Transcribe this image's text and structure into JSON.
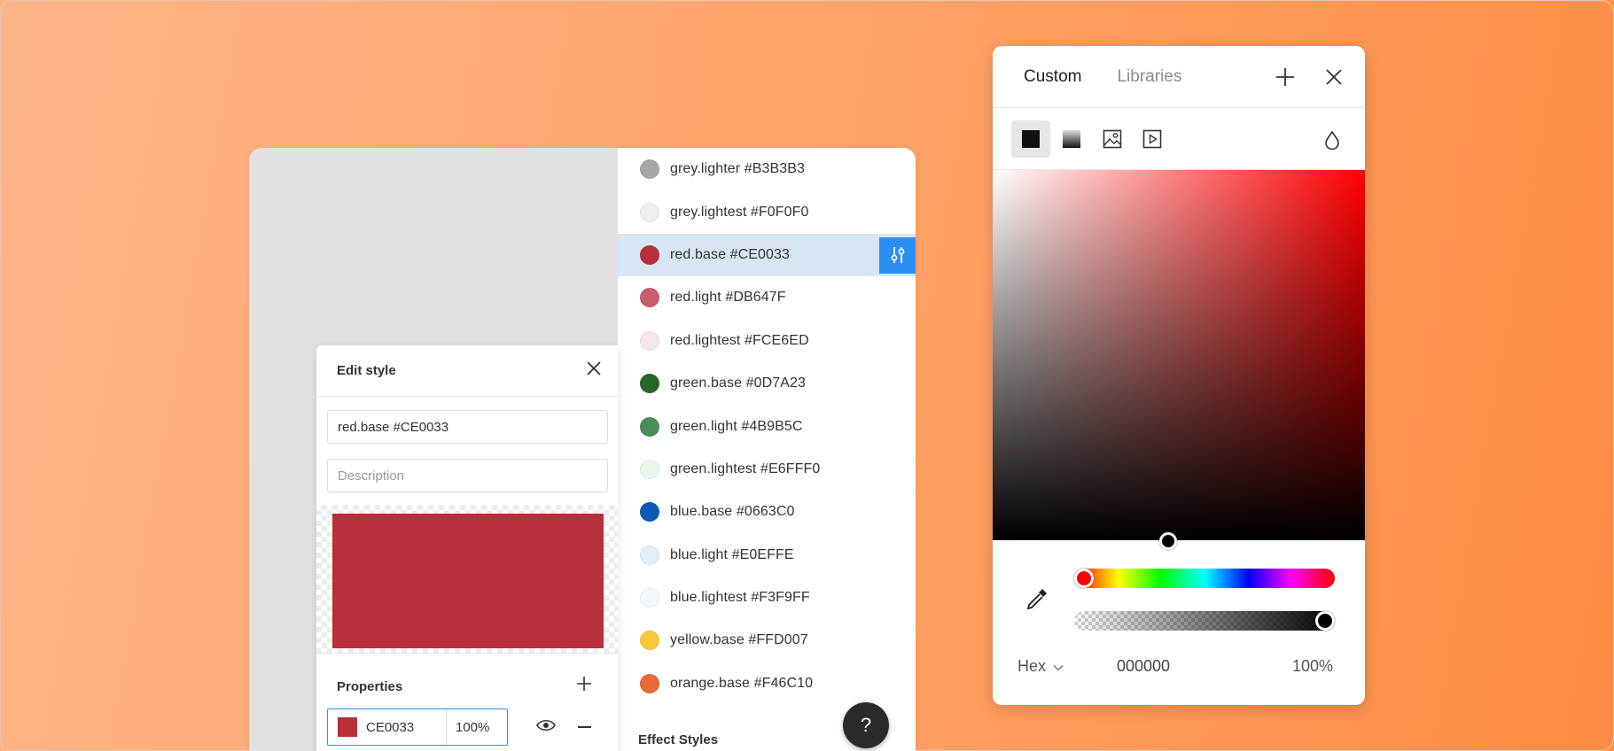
{
  "style_list": {
    "items": [
      {
        "label": "grey.lighter #B3B3B3",
        "color": "#A7A7A7",
        "selected": false
      },
      {
        "label": "grey.lightest #F0F0F0",
        "color": "#EFEFEF",
        "selected": false
      },
      {
        "label": "red.base #CE0033",
        "color": "#B82F39",
        "selected": true
      },
      {
        "label": "red.light #DB647F",
        "color": "#C95D6E",
        "selected": false
      },
      {
        "label": "red.lightest #FCE6ED",
        "color": "#F7E5EA",
        "selected": false
      },
      {
        "label": "green.base #0D7A23",
        "color": "#26662A",
        "selected": false
      },
      {
        "label": "green.light #4B9B5C",
        "color": "#4C8C58",
        "selected": false
      },
      {
        "label": "green.lightest #E6FFF0",
        "color": "#E6FAEC",
        "selected": false
      },
      {
        "label": "blue.base #0663C0",
        "color": "#0D5AB4",
        "selected": false
      },
      {
        "label": "blue.light #E0EFFE",
        "color": "#E2EDFC",
        "selected": false
      },
      {
        "label": "blue.lightest #F3F9FF",
        "color": "#F3F7FE",
        "selected": false
      },
      {
        "label": "yellow.base #FFD007",
        "color": "#F8C73D",
        "selected": false
      },
      {
        "label": "orange.base #F46C10",
        "color": "#E96A35",
        "selected": false
      }
    ],
    "effect_styles_title": "Effect Styles",
    "help_label": "?"
  },
  "edit_style": {
    "title": "Edit style",
    "name_value": "red.base #CE0033",
    "description_placeholder": "Description",
    "preview_color": "#B82F39",
    "properties_title": "Properties",
    "property": {
      "hex": "CE0033",
      "opacity": "100%",
      "swatch_color": "#B82F39"
    }
  },
  "color_picker": {
    "tabs": [
      {
        "label": "Custom",
        "active": true
      },
      {
        "label": "Libraries",
        "active": false
      }
    ],
    "fill_types": [
      "solid-fill-icon",
      "gradient-fill-icon",
      "image-fill-icon",
      "video-fill-icon"
    ],
    "mode": "Hex",
    "hex_value": "000000",
    "alpha_value": "100%",
    "hue_level": 0,
    "alpha_level": 1.0
  },
  "colors": {
    "accent": "#2B8EF5",
    "selected_row": "#D8E6F3"
  }
}
